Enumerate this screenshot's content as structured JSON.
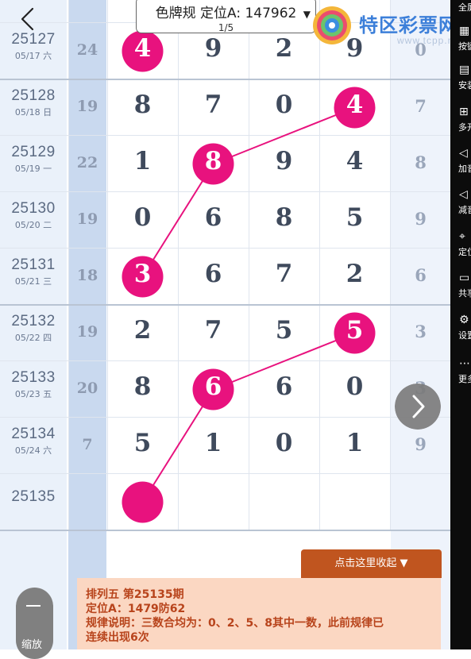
{
  "header": {
    "title": "色牌规 定位A: 147962",
    "page": "1/5",
    "caret": "▼",
    "logo_text": "特区彩票网",
    "logo_url": "www.tcpp.net"
  },
  "rows": [
    {
      "issue": "25127",
      "date": "05/17 六",
      "sum": "24",
      "nums": [
        "4",
        "9",
        "2",
        "9"
      ],
      "right": "0",
      "hit": 0
    },
    {
      "issue": "25128",
      "date": "05/18 日",
      "sum": "19",
      "nums": [
        "8",
        "7",
        "0",
        "4"
      ],
      "right": "7",
      "hit": 3
    },
    {
      "issue": "25129",
      "date": "05/19 一",
      "sum": "22",
      "nums": [
        "1",
        "8",
        "9",
        "4"
      ],
      "right": "8",
      "hit": 1
    },
    {
      "issue": "25130",
      "date": "05/20 二",
      "sum": "19",
      "nums": [
        "0",
        "6",
        "8",
        "5"
      ],
      "right": "9",
      "hit": -1
    },
    {
      "issue": "25131",
      "date": "05/21 三",
      "sum": "18",
      "nums": [
        "3",
        "6",
        "7",
        "2"
      ],
      "right": "6",
      "hit": 0
    },
    {
      "issue": "25132",
      "date": "05/22 四",
      "sum": "19",
      "nums": [
        "2",
        "7",
        "5",
        "5"
      ],
      "right": "3",
      "hit": 3
    },
    {
      "issue": "25133",
      "date": "05/23 五",
      "sum": "20",
      "nums": [
        "8",
        "6",
        "6",
        "0"
      ],
      "right": "3",
      "hit": 1
    },
    {
      "issue": "25134",
      "date": "05/24 六",
      "sum": "7",
      "nums": [
        "5",
        "1",
        "0",
        "1"
      ],
      "right": "9",
      "hit": -1
    },
    {
      "issue": "25135",
      "date": "",
      "sum": "",
      "nums": [
        "",
        "",
        "",
        ""
      ],
      "right": "",
      "hit": 0
    }
  ],
  "toolbar": [
    {
      "label": "全屏",
      "icon": "fullscreen-icon"
    },
    {
      "label": "按键",
      "icon": "keyboard-icon"
    },
    {
      "label": "安装",
      "icon": "install-icon"
    },
    {
      "label": "多开",
      "icon": "multi-open-icon"
    },
    {
      "label": "加音",
      "icon": "volume-up-icon"
    },
    {
      "label": "减音",
      "icon": "volume-down-icon"
    },
    {
      "label": "定位",
      "icon": "location-icon"
    },
    {
      "label": "共享",
      "icon": "folder-icon"
    },
    {
      "label": "设置",
      "icon": "gear-icon"
    },
    {
      "label": "更多",
      "icon": "more-icon"
    }
  ],
  "collapse_label": "点击这里收起 ▼",
  "info": {
    "line1": "排列五 第25135期",
    "line2": "定位A：1479防62",
    "line3": "规律说明：三数合均为：0、2、5、8其中一数，此前规律已",
    "line4": "连续出现6次"
  },
  "zoom_label": "缩放",
  "colors": {
    "accent": "#e8127e",
    "grid_issue_bg": "#eaf1fa",
    "grid_sum_bg": "#c9d9ef",
    "info_bg": "#fbd7c2",
    "info_text": "#b8441c",
    "collapse_bg": "#c0551f"
  }
}
